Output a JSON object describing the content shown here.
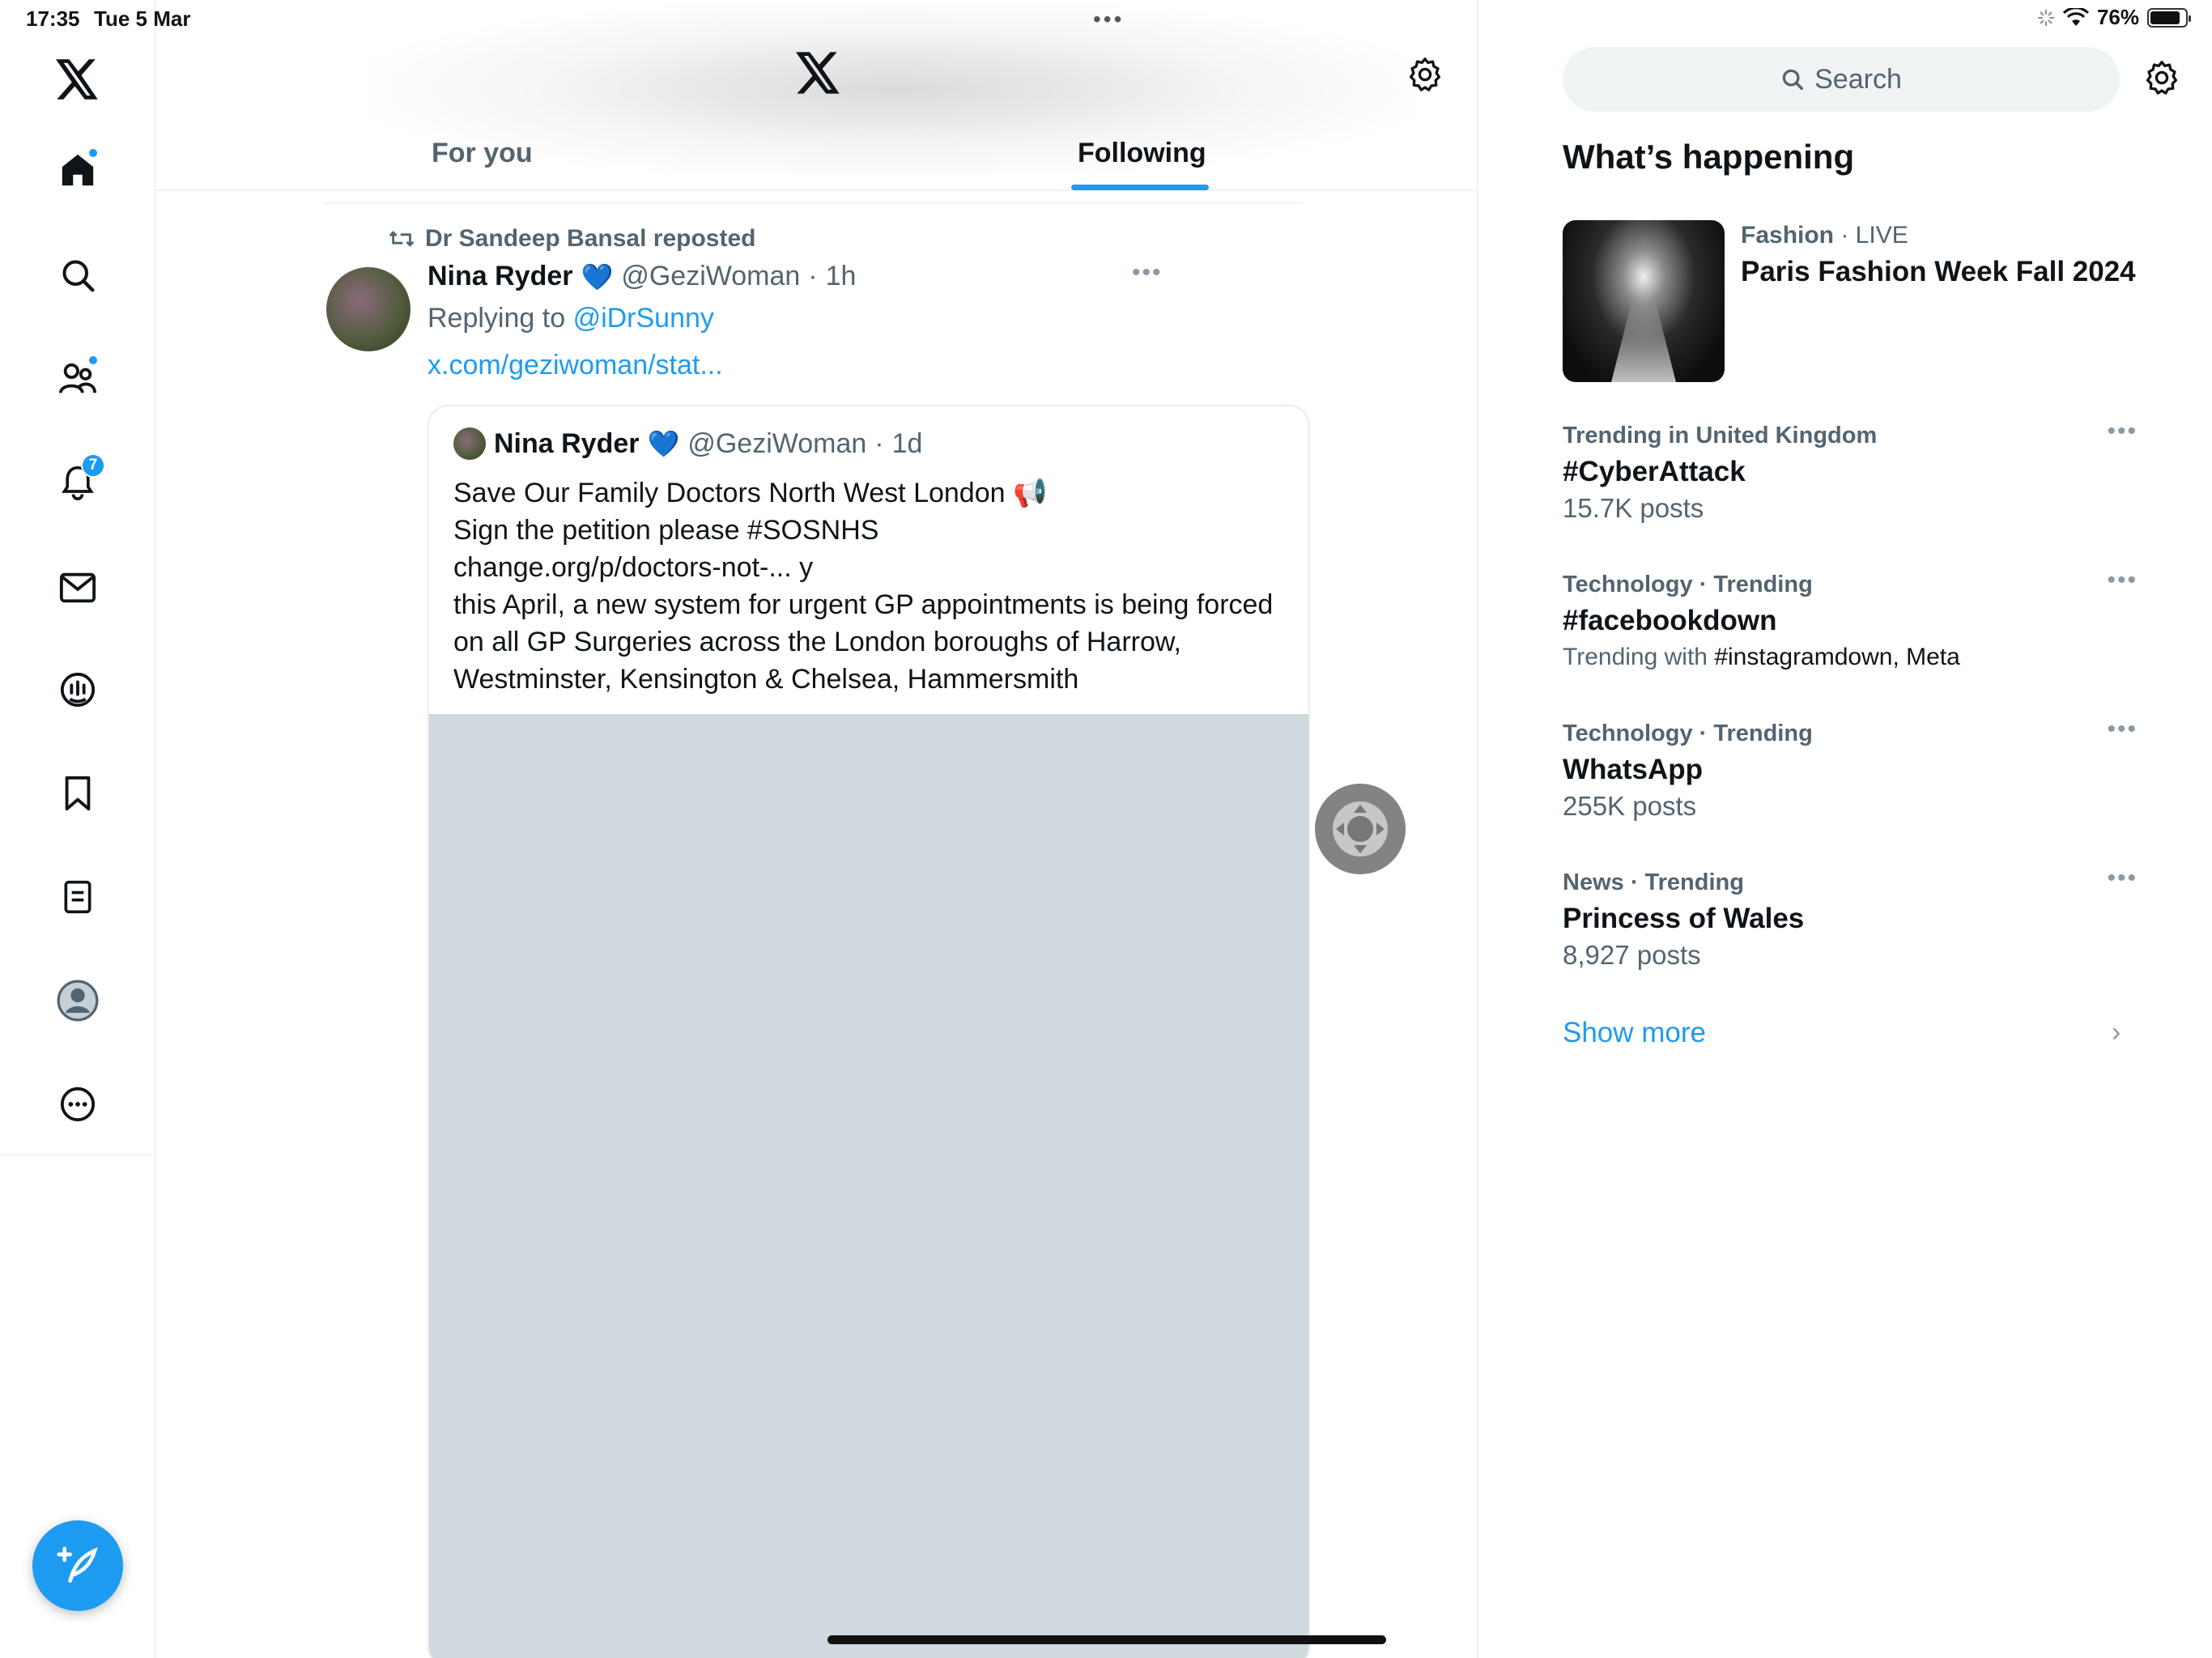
{
  "status_bar": {
    "time": "17:35",
    "date": "Tue 5 Mar",
    "battery": "76%"
  },
  "nav": {
    "notifications_count": "7",
    "items": [
      "home",
      "explore",
      "communities",
      "notifications",
      "messages",
      "spaces",
      "bookmarks",
      "lists",
      "profile",
      "more"
    ]
  },
  "tabs": {
    "for_you": "For you",
    "following": "Following",
    "active": "Following"
  },
  "post": {
    "reposted_by": "Dr Sandeep Bansal reposted",
    "author_name": "Nina Ryder",
    "author_emoji": "💙",
    "author_handle": "@GeziWoman",
    "time_sep": "·",
    "time": "1h",
    "replying_prefix": "Replying to",
    "replying_to": "@iDrSunny",
    "link": "x.com/geziwoman/stat..."
  },
  "quote": {
    "author_name": "Nina Ryder",
    "author_emoji": "💙",
    "author_handle": "@GeziWoman",
    "time": "1d",
    "lines": [
      "Save Our Family Doctors North West London 📢",
      "Sign the petition please #SOSNHS",
      "change.org/p/doctors-not-...  y",
      "this April, a new system for urgent GP appointments is being forced on all GP Surgeries across the London boroughs of Harrow, Westminster, Kensington & Chelsea, Hammersmith"
    ]
  },
  "sidebar": {
    "search_placeholder": "Search",
    "heading": "What’s happening",
    "featured": {
      "category": "Fashion",
      "status": "· LIVE",
      "title": "Paris Fashion Week Fall 2024"
    },
    "trends": [
      {
        "category": "Trending in United Kingdom",
        "title": "#CyberAttack",
        "sub": "15.7K posts"
      },
      {
        "category": "Technology · Trending",
        "title": "#facebookdown",
        "sub_prefix": "Trending with",
        "sub_tags": "#instagramdown, Meta"
      },
      {
        "category": "Technology · Trending",
        "title": "WhatsApp",
        "sub": "255K posts"
      },
      {
        "category": "News · Trending",
        "title": "Princess of Wales",
        "sub": "8,927 posts"
      }
    ],
    "show_more": "Show more"
  },
  "colors": {
    "accent": "#1d9bf0",
    "secondary_text": "#536471",
    "media_placeholder": "#cfd9de"
  }
}
